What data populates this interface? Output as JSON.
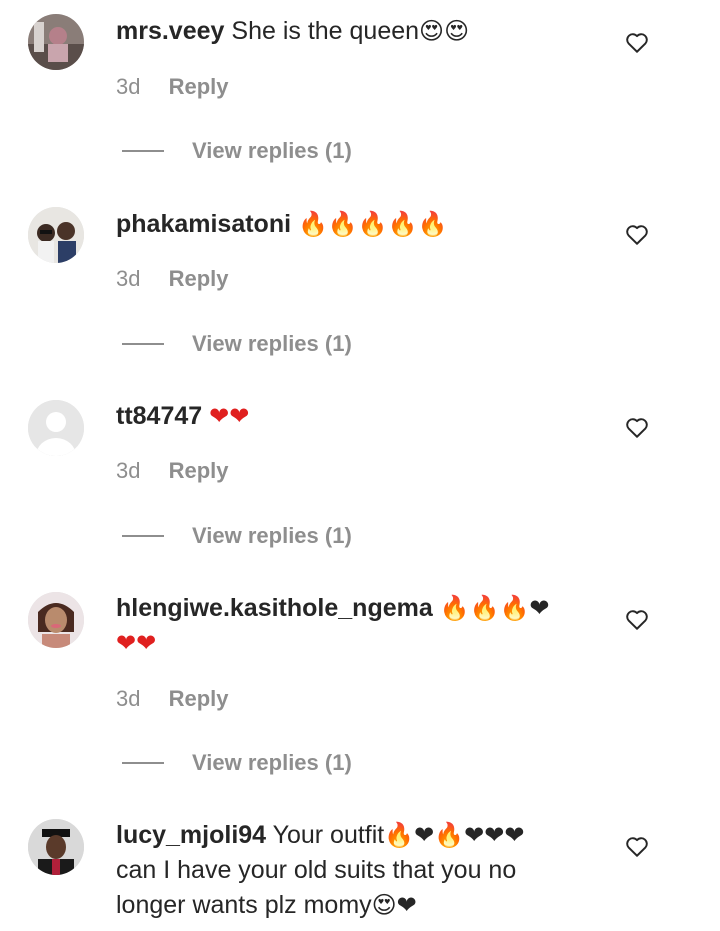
{
  "comments": [
    {
      "username": "mrs.veey",
      "text": "She is the queen",
      "emoji": "😍😍",
      "emoji_line2": "",
      "text2": "",
      "text3": "",
      "time": "3d",
      "reply_label": "Reply",
      "view_replies": "View replies (1)"
    },
    {
      "username": "phakamisatoni",
      "text": "",
      "emoji": "🔥🔥🔥🔥🔥",
      "emoji_line2": "",
      "text2": "",
      "text3": "",
      "time": "3d",
      "reply_label": "Reply",
      "view_replies": "View replies (1)"
    },
    {
      "username": "tt84747",
      "text": "",
      "emoji": "❤❤",
      "emoji_line2": "",
      "text2": "",
      "text3": "",
      "time": "3d",
      "reply_label": "Reply",
      "view_replies": "View replies (1)"
    },
    {
      "username": "hlengiwe.kasithole_ngema",
      "text": "",
      "emoji": "🔥🔥🔥❤",
      "emoji_line2": "❤❤",
      "text2": "",
      "text3": "",
      "time": "3d",
      "reply_label": "Reply",
      "view_replies": "View replies (1)"
    },
    {
      "username": "lucy_mjoli94",
      "text": "Your outfit",
      "emoji": "🔥❤🔥❤❤❤",
      "emoji_line2": "",
      "text2": "can I have your old suits that you no",
      "text3": "longer wants plz momy",
      "text3_emoji": "😍❤",
      "time": "",
      "reply_label": "",
      "view_replies": ""
    }
  ],
  "icons": {
    "like": "heart-outline-icon",
    "avatar_placeholder": "default-avatar-icon"
  },
  "colors": {
    "text": "#262626",
    "muted": "#8e8e8e",
    "fire": "#f57c00",
    "heart": "#e0201f"
  }
}
